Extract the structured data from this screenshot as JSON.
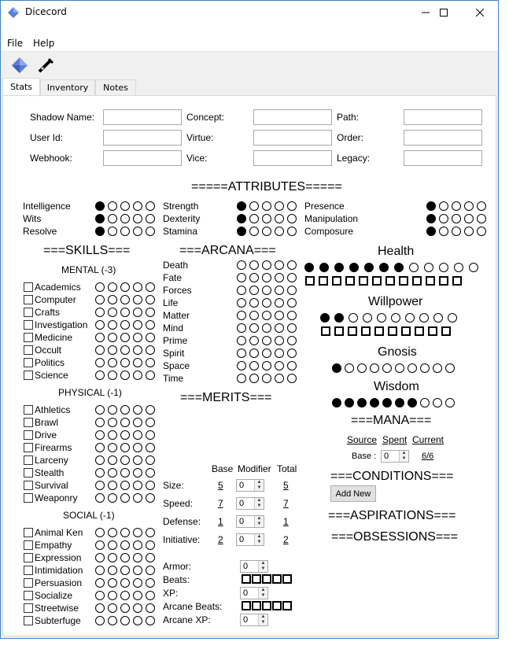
{
  "window": {
    "title": "Dicecord",
    "minimize": "—",
    "maximize": "☐",
    "close": "✕"
  },
  "menu": [
    "File",
    "Help"
  ],
  "toolbar": {
    "tool1": "dice-icon",
    "tool2": "pen-icon"
  },
  "tabs": [
    "Stats",
    "Inventory",
    "Notes"
  ],
  "fields": [
    {
      "label": "Shadow Name:",
      "value": ""
    },
    {
      "label": "Concept:",
      "value": ""
    },
    {
      "label": "Path:",
      "value": ""
    },
    {
      "label": "User Id:",
      "value": ""
    },
    {
      "label": "Virtue:",
      "value": ""
    },
    {
      "label": "Order:",
      "value": ""
    },
    {
      "label": "Webhook:",
      "value": ""
    },
    {
      "label": "Vice:",
      "value": ""
    },
    {
      "label": "Legacy:",
      "value": ""
    }
  ],
  "attributes": {
    "title": "=====ATTRIBUTES=====",
    "items": [
      {
        "name": "Intelligence",
        "value": 1
      },
      {
        "name": "Strength",
        "value": 1
      },
      {
        "name": "Presence",
        "value": 1
      },
      {
        "name": "Wits",
        "value": 1
      },
      {
        "name": "Dexterity",
        "value": 1
      },
      {
        "name": "Manipulation",
        "value": 1
      },
      {
        "name": "Resolve",
        "value": 1
      },
      {
        "name": "Stamina",
        "value": 1
      },
      {
        "name": "Composure",
        "value": 1
      }
    ]
  },
  "skills": {
    "title": "===SKILLS===",
    "groups": [
      {
        "title": "MENTAL (-3)",
        "items": [
          "Academics",
          "Computer",
          "Crafts",
          "Investigation",
          "Medicine",
          "Occult",
          "Politics",
          "Science"
        ]
      },
      {
        "title": "PHYSICAL (-1)",
        "items": [
          "Athletics",
          "Brawl",
          "Drive",
          "Firearms",
          "Larceny",
          "Stealth",
          "Survival",
          "Weaponry"
        ]
      },
      {
        "title": "SOCIAL (-1)",
        "items": [
          "Animal Ken",
          "Empathy",
          "Expression",
          "Intimidation",
          "Persuasion",
          "Socialize",
          "Streetwise",
          "Subterfuge"
        ]
      }
    ]
  },
  "arcana": {
    "title": "===ARCANA===",
    "items": [
      "Death",
      "Fate",
      "Forces",
      "Life",
      "Matter",
      "Mind",
      "Prime",
      "Spirit",
      "Space",
      "Time"
    ]
  },
  "merits": {
    "title": "===MERITS==="
  },
  "derived": {
    "headers": [
      "Base",
      "Modifier",
      "Total"
    ],
    "rows": [
      {
        "label": "Size:",
        "base": "5",
        "mod": "0",
        "total": "5"
      },
      {
        "label": "Speed:",
        "base": "7",
        "mod": "0",
        "total": "7"
      },
      {
        "label": "Defense:",
        "base": "1",
        "mod": "0",
        "total": "1"
      },
      {
        "label": "Initiative:",
        "base": "2",
        "mod": "0",
        "total": "2"
      }
    ]
  },
  "misc": {
    "armor_label": "Armor:",
    "armor_value": "0",
    "beats_label": "Beats:",
    "xp_label": "XP:",
    "xp_value": "0",
    "arcane_beats_label": "Arcane Beats:",
    "arcane_xp_label": "Arcane XP:",
    "arcane_xp_value": "0"
  },
  "health": {
    "title": "Health",
    "filled": 7,
    "max": 12
  },
  "willpower": {
    "title": "Willpower",
    "filled": 2,
    "max": 10
  },
  "gnosis": {
    "title": "Gnosis",
    "filled": 1,
    "max": 10
  },
  "wisdom": {
    "title": "Wisdom",
    "filled": 7,
    "max": 10
  },
  "mana": {
    "title": "===MANA===",
    "source": "Source",
    "spent": "Spent",
    "current": "Current",
    "base_label": "Base :",
    "base_value": "0",
    "current_value": "6/6"
  },
  "conditions": {
    "title": "===CONDITIONS===",
    "add_label": "Add New"
  },
  "aspirations": {
    "title": "===ASPIRATIONS==="
  },
  "obsessions": {
    "title": "===OBSESSIONS==="
  }
}
